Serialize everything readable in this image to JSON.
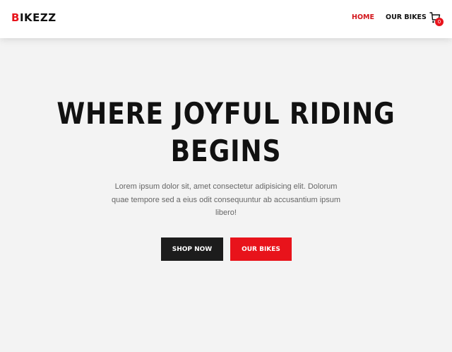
{
  "brand": {
    "logo_first": "B",
    "logo_rest": "IKEZZ",
    "accent_color": "#e8131b"
  },
  "nav": {
    "home": "HOME",
    "our_bikes": "OUR BIKES",
    "cart_icon": "shopping-cart-icon",
    "cart_count": "0"
  },
  "hero": {
    "title": "WHERE JOYFUL RIDING BEGINS",
    "text": "Lorem ipsum dolor sit, amet consectetur adipisicing elit. Dolorum quae tempore sed a eius odit consequuntur ab accusantium ipsum libero!",
    "shop_button": "SHOP NOW",
    "bikes_button": "OUR BIKES"
  }
}
